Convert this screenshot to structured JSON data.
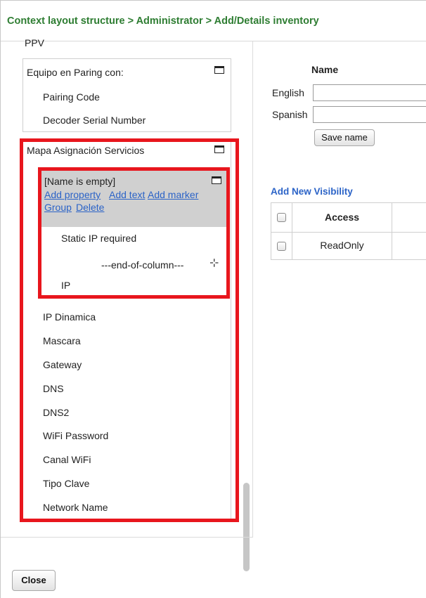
{
  "header": {
    "breadcrumb": "Context layout structure > Administrator > Add/Details inventory"
  },
  "tree": {
    "ppv_label": "PPV",
    "pairing_group": {
      "title": "Equipo en Paring con:",
      "items": [
        "Pairing Code",
        "Decoder Serial Number"
      ]
    },
    "services_group": {
      "title": "Mapa Asignación Servicios",
      "inner_group": {
        "title": "[Name is empty]",
        "actions": [
          "Add property",
          "Add text",
          "Add marker",
          "Group",
          "Delete"
        ],
        "items": [
          "Static IP required",
          "---end-of-column---",
          "IP"
        ]
      },
      "items": [
        "IP Dinamica",
        "Mascara",
        "Gateway",
        "DNS",
        "DNS2",
        "WiFi Password",
        "Canal WiFi",
        "Tipo Clave",
        "Network Name"
      ]
    }
  },
  "name_panel": {
    "heading": "Name",
    "english_label": "English",
    "spanish_label": "Spanish",
    "english_value": "",
    "spanish_value": "",
    "save_button": "Save name"
  },
  "visibility": {
    "title": "Add New Visibility",
    "columns": [
      "",
      "Access"
    ],
    "rows": [
      {
        "access": "ReadOnly"
      }
    ]
  },
  "footer": {
    "close_button": "Close"
  },
  "colors": {
    "breadcrumb": "#2e7d32",
    "link": "#2b63c7",
    "highlight_border": "#e8161d",
    "selected_band": "#d0d0d0"
  }
}
